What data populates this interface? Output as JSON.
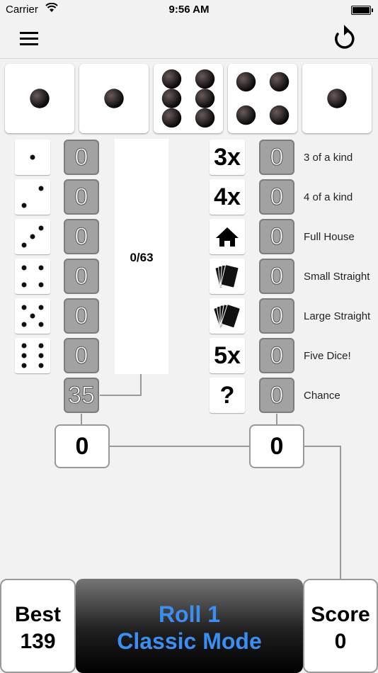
{
  "status_bar": {
    "carrier": "Carrier",
    "time": "9:56 AM"
  },
  "dice": [
    1,
    1,
    6,
    4,
    1
  ],
  "upper": {
    "rows": [
      {
        "face": 1,
        "score": "0"
      },
      {
        "face": 2,
        "score": "0"
      },
      {
        "face": 3,
        "score": "0"
      },
      {
        "face": 4,
        "score": "0"
      },
      {
        "face": 5,
        "score": "0"
      },
      {
        "face": 6,
        "score": "0"
      }
    ],
    "bonus": "35",
    "progress": "0/63",
    "total": "0"
  },
  "lower": {
    "rows": [
      {
        "icon": "3x",
        "score": "0",
        "label": "3 of a kind"
      },
      {
        "icon": "4x",
        "score": "0",
        "label": "4 of a kind"
      },
      {
        "icon": "house-icon",
        "score": "0",
        "label": "Full House"
      },
      {
        "icon": "cards-small-icon",
        "score": "0",
        "label": "Small Straight"
      },
      {
        "icon": "cards-large-icon",
        "score": "0",
        "label": "Large Straight"
      },
      {
        "icon": "5x",
        "score": "0",
        "label": "Five Dice!"
      },
      {
        "icon": "?",
        "score": "0",
        "label": "Chance"
      }
    ],
    "total": "0"
  },
  "bottom": {
    "best_label": "Best",
    "best_value": "139",
    "roll_line1": "Roll 1",
    "roll_line2": "Classic Mode",
    "score_label": "Score",
    "score_value": "0"
  },
  "colors": {
    "accent": "#3b8ef2",
    "score_box": "#a2a2a2"
  }
}
